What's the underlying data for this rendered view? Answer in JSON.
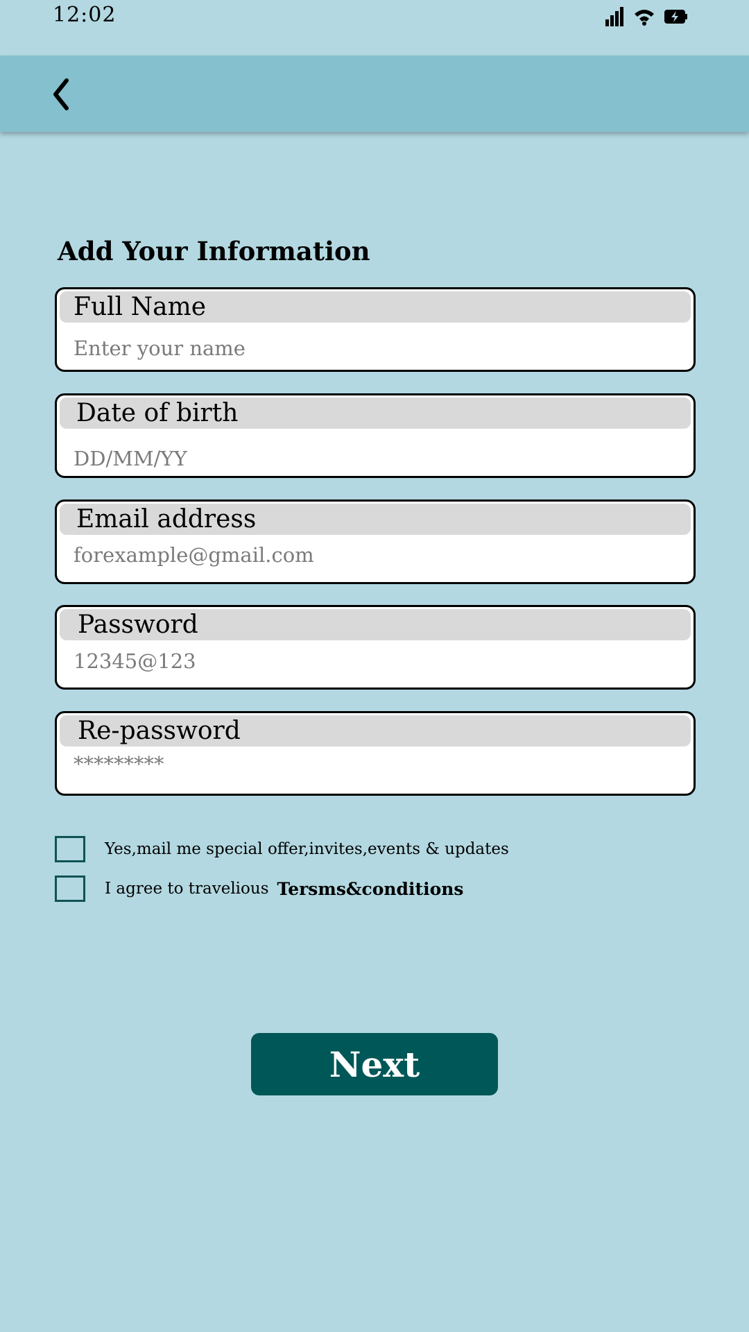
{
  "status_bar": {
    "time": "12:02",
    "icons": [
      "signal-icon",
      "wifi-icon",
      "battery-charging-icon"
    ]
  },
  "app_bar": {
    "back_icon": "chevron-left-icon",
    "color": "#85c0ce"
  },
  "heading": "Add Your Information",
  "fields": {
    "full_name": {
      "label": "Full Name",
      "placeholder": "Enter your name"
    },
    "dob": {
      "label": "Date of birth",
      "placeholder": "DD/MM/YY"
    },
    "email": {
      "label": "Email address",
      "placeholder": "forexample@gmail.com"
    },
    "password": {
      "label": "Password",
      "placeholder": "12345@123"
    },
    "repassword": {
      "label": "Re-password",
      "placeholder": "*********"
    }
  },
  "checkboxes": {
    "offers": {
      "text": "Yes,mail me special offer,invites,events & updates",
      "checked": false
    },
    "terms": {
      "text": "I agree to travelious",
      "link": "Tersms&conditions",
      "checked": false
    }
  },
  "next_button": {
    "label": "Next"
  },
  "colors": {
    "background": "#b3d8e1",
    "accent": "#005757",
    "field_header": "#d9d9d9"
  }
}
